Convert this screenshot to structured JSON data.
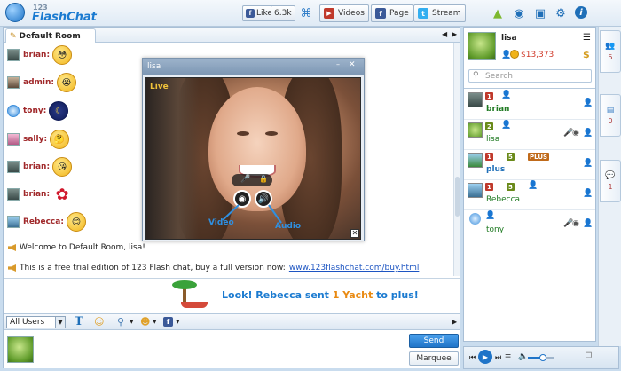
{
  "app": {
    "logo_small": "123",
    "logo_text": "FlashChat"
  },
  "topbar": {
    "like_label": "Like",
    "like_count": "6.3k",
    "videos_label": "Videos",
    "page_label": "Page",
    "stream_label": "Stream"
  },
  "room": {
    "tab_label": "Default Room"
  },
  "messages": [
    {
      "user": "brian:",
      "emoticon": "embarrassed-emoticon"
    },
    {
      "user": "admin:",
      "emoticon": "crying-emoticon"
    },
    {
      "user": "tony:",
      "emoticon": "moon-emoticon"
    },
    {
      "user": "sally:",
      "emoticon": "thinking-emoticon"
    },
    {
      "user": "brian:",
      "emoticon": "kiss-emoticon"
    },
    {
      "user": "brian:",
      "emoticon": "rose-emoticon"
    },
    {
      "user": "Rebecca:",
      "emoticon": "shy-emoticon"
    }
  ],
  "system_messages": {
    "welcome": "Welcome to Default Room, lisa!",
    "trial_text": "This is a free trial edition of 123 Flash chat, buy a full version now:",
    "trial_link": "www.123flashchat.com/buy.html"
  },
  "gift": {
    "prefix": "Look! Rebecca sent ",
    "count": "1",
    "item": "Yacht",
    "suffix": " to plus!"
  },
  "toolbar": {
    "user_filter": "All Users"
  },
  "actions": {
    "send_label": "Send",
    "marquee_label": "Marquee"
  },
  "profile": {
    "name": "lisa",
    "coins": "$13,373",
    "coin_badge": "$"
  },
  "search": {
    "placeholder": "Search"
  },
  "users": [
    {
      "name": "brian",
      "level": "1",
      "rank": "",
      "plus": ""
    },
    {
      "name": "lisa",
      "level": "2",
      "rank": "",
      "plus": ""
    },
    {
      "name": "plus",
      "level": "1",
      "rank": "5",
      "plus": "PLUS"
    },
    {
      "name": "Rebecca",
      "level": "1",
      "rank": "5",
      "plus": ""
    },
    {
      "name": "tony",
      "level": "",
      "rank": "",
      "plus": ""
    }
  ],
  "side_tabs": [
    {
      "count": "5"
    },
    {
      "count": "0"
    },
    {
      "count": "1"
    }
  ],
  "video": {
    "title": "lisa",
    "live": "Live",
    "video_label": "Video",
    "audio_label": "Audio"
  },
  "colors": {
    "accent": "#1a7ad0",
    "send_button": "#2b87d8",
    "name_red": "#a0282a",
    "user_green": "#1f7a22",
    "gift_orange": "#e98a12"
  }
}
